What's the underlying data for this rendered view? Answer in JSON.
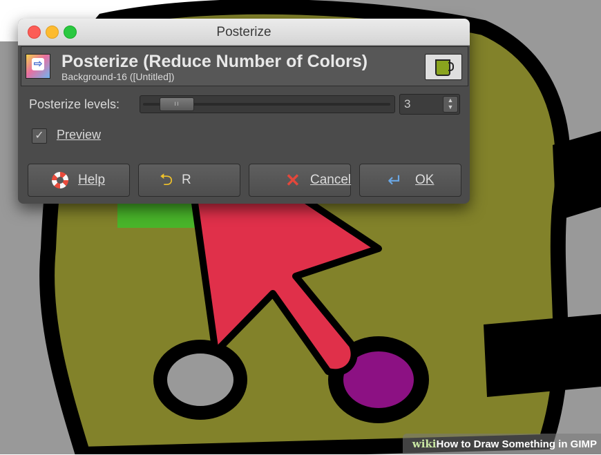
{
  "window": {
    "title": "Posterize"
  },
  "header": {
    "title": "Posterize (Reduce Number of Colors)",
    "subtitle": "Background-16 ([Untitled])",
    "plugin_icon": "posterize-plugin-icon",
    "thumbnail_icon": "gimp-mug-icon"
  },
  "levels": {
    "label": "Posterize levels:",
    "value": "3"
  },
  "preview": {
    "label": "Preview",
    "checked": true
  },
  "buttons": {
    "help": "Help",
    "reset": "R",
    "cancel": "Cancel",
    "ok": "OK"
  },
  "watermark": {
    "wiki": "wiki",
    "text": "How to Draw Something in GIMP"
  },
  "colors": {
    "dialog_bg": "#4b4b4b",
    "canvas_olive": "#82822a",
    "arrow_red": "#e0304a",
    "purple_spot": "#8c1183",
    "green_fill": "#49b52a"
  }
}
